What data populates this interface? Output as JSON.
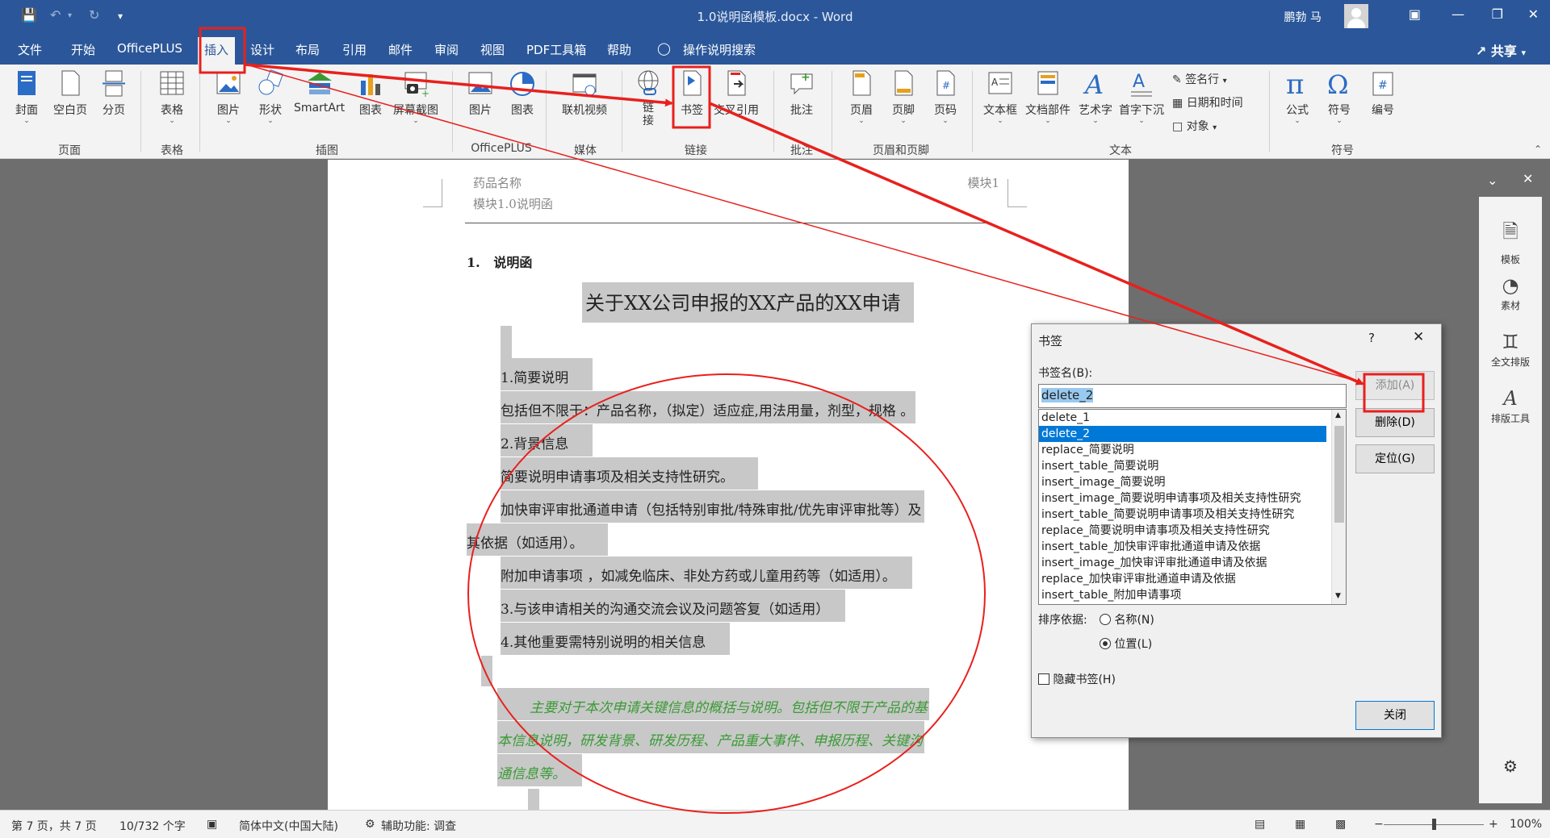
{
  "window": {
    "title": "1.0说明函模板.docx  -  Word",
    "user": "鹏勃 马"
  },
  "tabs": [
    "文件",
    "开始",
    "OfficePLUS",
    "插入",
    "设计",
    "布局",
    "引用",
    "邮件",
    "审阅",
    "视图",
    "PDF工具箱",
    "帮助"
  ],
  "tell_me": "操作说明搜索",
  "share": "共享",
  "ribbon": {
    "buttons": {
      "cover": "封面",
      "blank": "空白页",
      "pagebreak": "分页",
      "table": "表格",
      "picture": "图片",
      "shapes": "形状",
      "smartart": "SmartArt",
      "chart": "图表",
      "screenshot": "屏幕截图",
      "op_picture": "图片",
      "op_chart": "图表",
      "online_video": "联机视频",
      "link": "链接",
      "bookmark": "书签",
      "crossref": "交叉引用",
      "comment": "批注",
      "header": "页眉",
      "footer": "页脚",
      "pagenum": "页码",
      "textbox": "文本框",
      "quickparts": "文档部件",
      "wordart": "艺术字",
      "dropcap": "首字下沉",
      "signature": "签名行",
      "datetime": "日期和时间",
      "object": "对象",
      "equation": "公式",
      "symbol": "符号",
      "number": "编号"
    },
    "groups": {
      "pages": "页面",
      "tables": "表格",
      "illustrations": "插图",
      "officeplus": "OfficePLUS",
      "media": "媒体",
      "links": "链接",
      "comments": "批注",
      "headerfooter": "页眉和页脚",
      "text": "文本",
      "symbols": "符号"
    }
  },
  "document": {
    "header_left": "药品名称",
    "header_right": "模块1",
    "header_sub": "模块1.0说明函",
    "heading_num": "1.",
    "heading": "说明函",
    "title": "关于XX公司申报的XX产品的XX申请",
    "lines": [
      "1.简要说明",
      "包括但不限于：产品名称，（拟定）适应症,用法用量，剂型，规格  。",
      "2.背景信息",
      "简要说明申请事项及相关支持性研究。",
      "加快审评审批通道申请（包括特别审批/特殊审批/优先审评审批等）及",
      "其依据（如适用）。",
      "附加申请事项 ，如减免临床、非处方药或儿童用药等（如适用）。",
      "3.与该申请相关的沟通交流会议及问题答复（如适用）",
      "4.其他重要需特别说明的相关信息"
    ],
    "green_lines": [
      "主要对于本次申请关键信息的概括与说明。包括但不限于产品的基",
      "本信息说明，研发背景、研发历程、产品重大事件、申报历程、关键沟",
      "通信息等。"
    ]
  },
  "dialog": {
    "title": "书签",
    "help": "?",
    "name_label": "书签名(B):",
    "name_value": "delete_2",
    "items": [
      "delete_1",
      "delete_2",
      "replace_简要说明",
      "insert_table_简要说明",
      "insert_image_简要说明",
      "insert_image_简要说明申请事项及相关支持性研究",
      "insert_table_简要说明申请事项及相关支持性研究",
      "replace_简要说明申请事项及相关支持性研究",
      "insert_table_加快审评审批通道申请及依据",
      "insert_image_加快审评审批通道申请及依据",
      "replace_加快审评审批通道申请及依据",
      "insert_table_附加申请事项"
    ],
    "selected_index": 1,
    "sort_label": "排序依据:",
    "sort_name": "名称(N)",
    "sort_position": "位置(L)",
    "sort_selected": "position",
    "hidden_label": "隐藏书签(H)",
    "add": "添加(A)",
    "delete": "删除(D)",
    "goto": "定位(G)",
    "close": "关闭"
  },
  "side_panel": {
    "items": [
      "模板",
      "素材",
      "全文排版",
      "排版工具"
    ]
  },
  "status": {
    "page": "第 7 页，共 7 页",
    "words": "10/732 个字",
    "lang": "简体中文(中国大陆)",
    "access": "辅助功能: 调查",
    "zoom": "100%"
  },
  "colors": {
    "word_blue": "#2b579a",
    "annotation_red": "#e8201d",
    "selection_blue": "#0078d7",
    "green_text": "#3a9b35"
  }
}
